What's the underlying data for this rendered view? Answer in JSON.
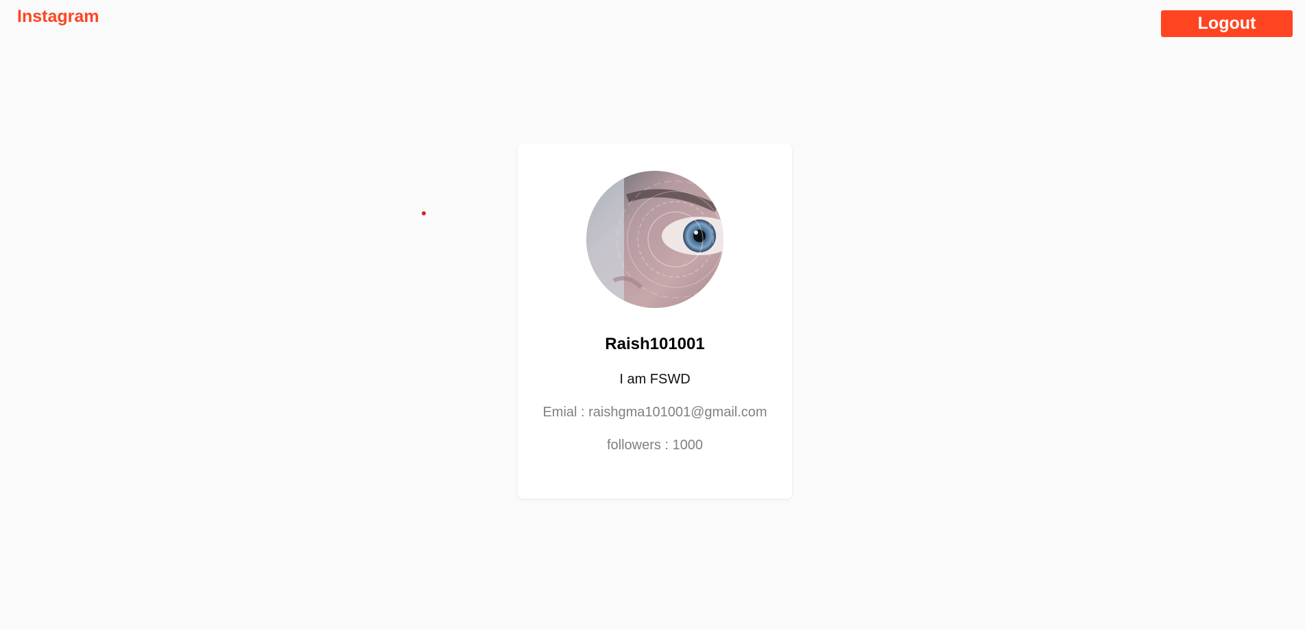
{
  "header": {
    "brand": "Instagram",
    "logout_label": "Logout"
  },
  "profile": {
    "avatar_icon": "profile-photo-eye",
    "username": "Raish101001",
    "bio": "I am FSWD",
    "email": "Emial : raishgma101001@gmail.com",
    "followers": "followers : 1000"
  },
  "colors": {
    "accent": "#ff4422",
    "background": "#fafafa",
    "card": "#ffffff",
    "muted_text": "#808080"
  }
}
